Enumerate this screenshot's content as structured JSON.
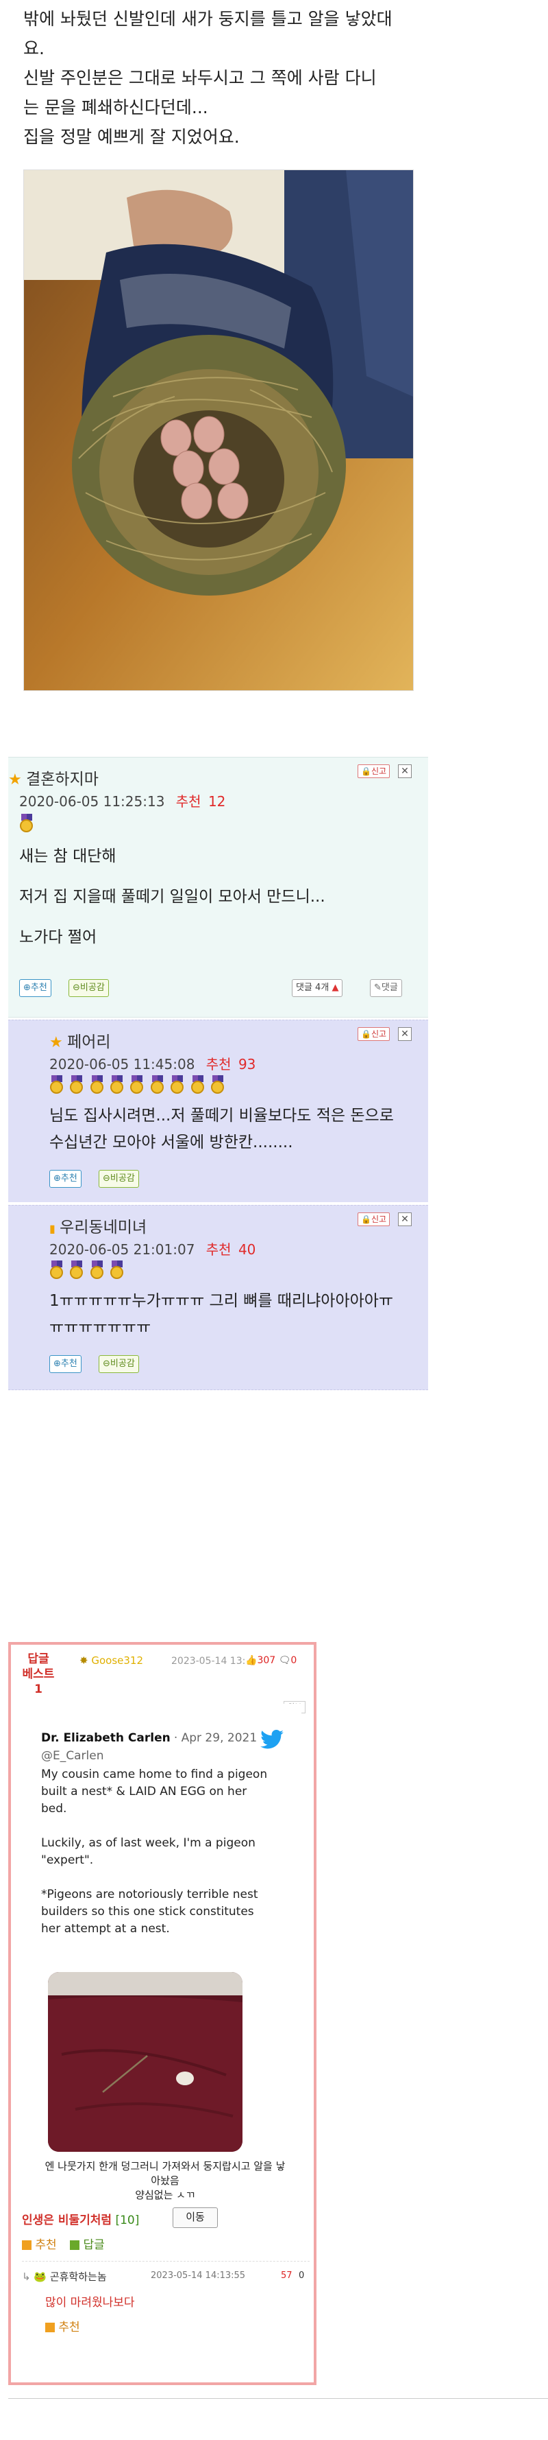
{
  "post": {
    "lines": [
      "밖에 놔뒀던 신발인데 새가 둥지를 틀고 알을 낳았대",
      "요.",
      "신발 주인분은 그대로 놔두시고 그 쪽에 사람 다니",
      "는 문을 폐쇄하신다던데...",
      "집을 정말 예쁘게 잘 지었어요."
    ]
  },
  "comments": [
    {
      "nick": "결혼하지마",
      "date": "2020-06-05 11:25:13",
      "rec_label": "추천",
      "rec_count": "12",
      "medals": 1,
      "body_lines": [
        "새는 참 대단해",
        "",
        "저거 집 지을때 풀떼기 일일이 모아서 만드니...",
        "",
        "노가다 쩔어"
      ],
      "btn_rec": "추천",
      "btn_unrec": "비공감",
      "reply_label": "댓글 4개",
      "reply_btn": "댓글",
      "report": "신고"
    },
    {
      "nick": "페어리",
      "date": "2020-06-05 11:45:08",
      "rec_label": "추천",
      "rec_count": "93",
      "medals": 9,
      "body_lines": [
        "님도 집사시려면...저 풀떼기 비율보다도 적은 돈으로",
        "수십년간 모아야 서울에 방한칸........"
      ],
      "btn_rec": "추천",
      "btn_unrec": "비공감",
      "report": "신고"
    },
    {
      "nick": "우리동네미녀",
      "date": "2020-06-05 21:01:07",
      "rec_label": "추천",
      "rec_count": "40",
      "medals": 4,
      "body_lines": [
        "1ㅠㅠㅠㅠㅠ누가ㅠㅠㅠ 그리 뼈를 때리냐아아아아ㅠ",
        "ㅠㅠㅠㅠㅠㅠㅠ"
      ],
      "btn_rec": "추천",
      "btn_unrec": "비공감",
      "report": "신고"
    }
  ],
  "best": {
    "label_line1": "답글",
    "label_line2": "베스트1",
    "user": "Goose312",
    "date": "2023-05-14 13:",
    "count": "307",
    "comment_count": "0",
    "orig_label": "원본",
    "tweet": {
      "name": "Dr. Elizabeth Carlen",
      "date": "· Apr 29, 2021",
      "handle": "@E_Carlen",
      "lines1": [
        "My cousin came home to find a pigeon",
        "built a nest* & LAID AN EGG on her",
        "bed."
      ],
      "lines2": [
        "Luckily, as of last week, I'm a pigeon",
        "\"expert\"."
      ],
      "lines3": [
        "*Pigeons are notoriously terrible nest",
        "builders so this one stick constitutes",
        "her attempt at a nest."
      ]
    },
    "caption_lines": [
      "엔 나뭇가지 한개 덩그러니 가져와서 둥지랍시고 알을 낳",
      "아놨음",
      "양심없는 ㅅㄲ"
    ],
    "title": "인생은 비둘기처럼",
    "title_count": "[10]",
    "move_btn": "이동",
    "rec_label": "추천",
    "reply_label": "답글",
    "sub_user": "곤휴학하는놈",
    "sub_date": "2023-05-14 14:13:55",
    "sub_count": "57",
    "sub_zero": "0",
    "sub_text": "많이 마려웠나보다",
    "sub_rec": "추천"
  },
  "colors": {
    "accent_red": "#e02a2a",
    "comment_bg": "#eef8f6",
    "reply_bg": "#dfe0f7",
    "best_border": "#f2a6a6",
    "twitter_blue": "#1da1f2"
  }
}
